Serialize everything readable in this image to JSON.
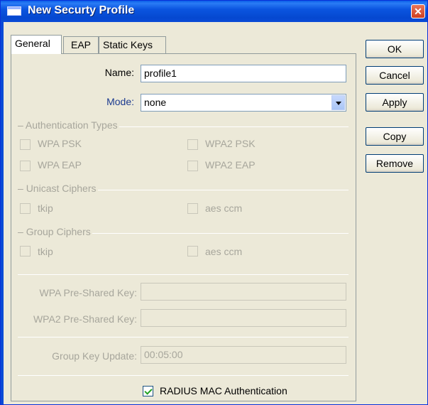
{
  "window": {
    "title": "New Securty Profile",
    "close_glyph": "✕"
  },
  "tabs": [
    {
      "label": "General",
      "active": true
    },
    {
      "label": "EAP",
      "active": false
    },
    {
      "label": "Static Keys",
      "active": false
    }
  ],
  "buttons": {
    "ok": "OK",
    "cancel": "Cancel",
    "apply": "Apply",
    "copy": "Copy",
    "remove": "Remove"
  },
  "form": {
    "name_label": "Name:",
    "name_value": "profile1",
    "mode_label": "Mode:",
    "mode_value": "none"
  },
  "auth_types": {
    "title": "Authentication Types",
    "options": [
      {
        "label": "WPA PSK",
        "checked": false
      },
      {
        "label": "WPA2 PSK",
        "checked": false
      },
      {
        "label": "WPA EAP",
        "checked": false
      },
      {
        "label": "WPA2 EAP",
        "checked": false
      }
    ]
  },
  "unicast_ciphers": {
    "title": "Unicast Ciphers",
    "options": [
      {
        "label": "tkip",
        "checked": false
      },
      {
        "label": "aes ccm",
        "checked": false
      }
    ]
  },
  "group_ciphers": {
    "title": "Group Ciphers",
    "options": [
      {
        "label": "tkip",
        "checked": false
      },
      {
        "label": "aes ccm",
        "checked": false
      }
    ]
  },
  "keys": {
    "wpa_label": "WPA Pre-Shared Key:",
    "wpa_value": "",
    "wpa2_label": "WPA2 Pre-Shared Key:",
    "wpa2_value": "",
    "group_update_label": "Group Key Update:",
    "group_update_value": "00:05:00"
  },
  "radius": {
    "label": "RADIUS MAC Authentication",
    "checked": true
  },
  "colors": {
    "title_bar": "#0a4ad6",
    "disabled_text": "#a7a69c",
    "link_label": "#1b3a8f"
  }
}
